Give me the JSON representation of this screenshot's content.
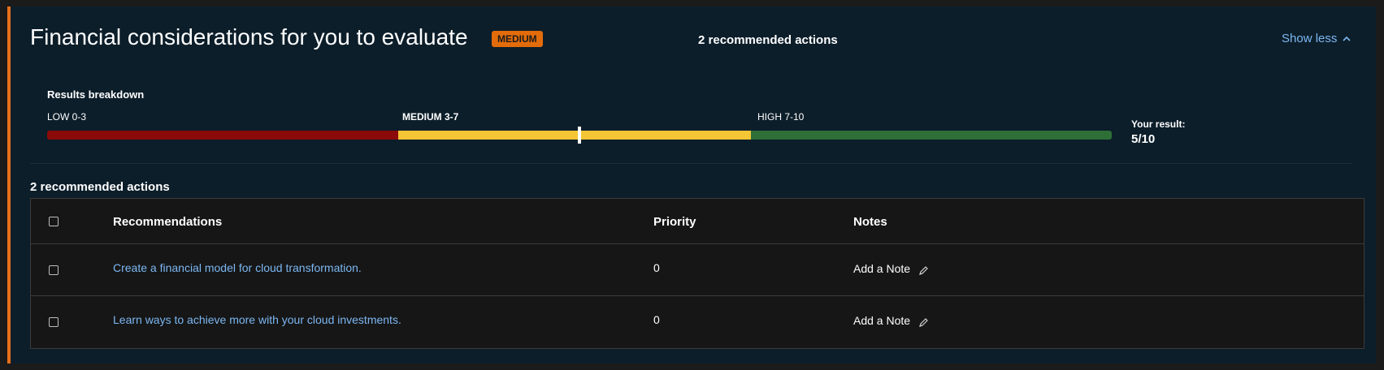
{
  "header": {
    "title": "Financial considerations for you to evaluate",
    "badge": "MEDIUM",
    "actions_count": "2 recommended actions",
    "show_less": "Show less"
  },
  "breakdown": {
    "title": "Results breakdown",
    "low_label": "LOW 0-3",
    "medium_label": "MEDIUM 3-7",
    "high_label": "HIGH 7-10",
    "your_result_label": "Your result:",
    "your_result_value": "5/10",
    "score": 5,
    "scale_max": 10,
    "colors": {
      "low": "#8b0a0a",
      "medium": "#f4c534",
      "high": "#2e6e37"
    }
  },
  "recommendations": {
    "section_title": "2 recommended actions",
    "columns": [
      "Recommendations",
      "Priority",
      "Notes"
    ],
    "rows": [
      {
        "text": "Create a financial model for cloud transformation.",
        "priority": "0",
        "note": "Add a Note"
      },
      {
        "text": "Learn ways to achieve more with your cloud investments.",
        "priority": "0",
        "note": "Add a Note"
      }
    ]
  },
  "icons": {
    "show_less": "chevron-up-icon",
    "note": "pencil-icon"
  },
  "accent_color": "#e8701a"
}
